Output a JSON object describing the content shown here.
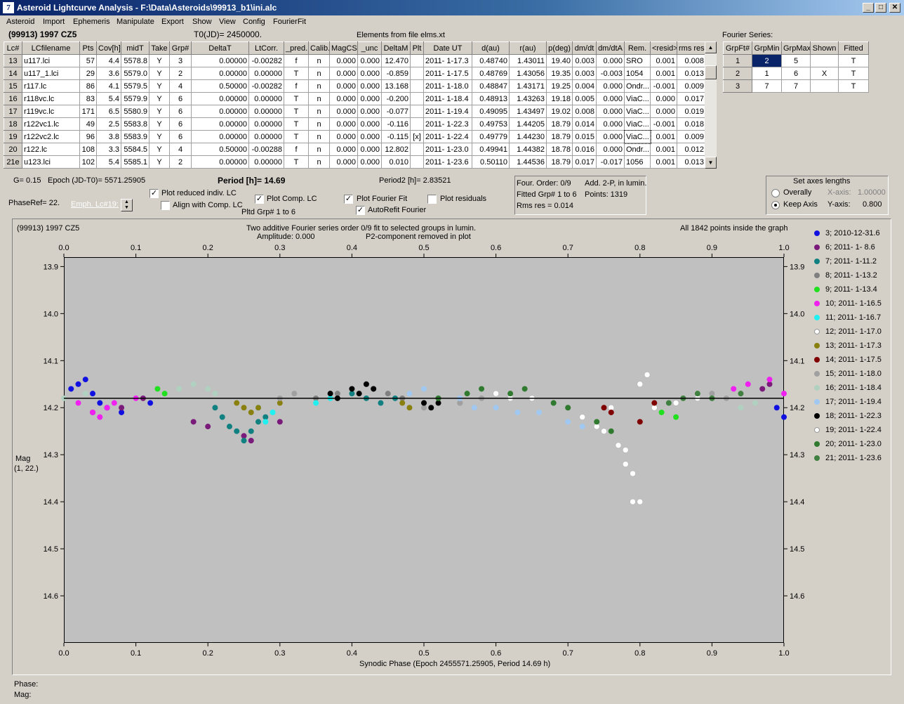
{
  "window": {
    "title": "Asteroid Lightcurve Analysis - F:\\Data\\Asteroids\\99913_b1\\ini.alc",
    "icon": "app-icon"
  },
  "menu": [
    "Asteroid",
    "Import",
    "Ephemeris",
    "Manipulate",
    "Export",
    "Show",
    "View",
    "Config",
    "FourierFit"
  ],
  "header": {
    "object": "(99913) 1997 CZ5",
    "t0": "T0(JD)= 2450000.",
    "elements": "Elements from file elms.xt"
  },
  "lc_table": {
    "columns": [
      "Lc#",
      "LCfilename",
      "Pts",
      "Cov[h]",
      "midT",
      "Take",
      "Grp#",
      "DeltaT",
      "LtCorr.",
      "_pred.",
      "Calib.",
      "MagCS",
      "_unc",
      "DeltaM",
      "Plt",
      "Date UT",
      "d(au)",
      "r(au)",
      "p(deg)",
      "dm/dt",
      "dm/dtA",
      "Rem.",
      "<resid>",
      "rms res"
    ],
    "rows": [
      [
        "13",
        "u117.lci",
        "57",
        "4.4",
        "5578.8",
        "Y",
        "3",
        "0.00000",
        "-0.00282",
        "f",
        "n",
        "0.000",
        "0.000",
        "12.470",
        "",
        "2011- 1-17.3",
        "0.48740",
        "1.43011",
        "19.40",
        "0.003",
        "0.000",
        "SRO",
        "0.001",
        "0.008"
      ],
      [
        "14",
        "u117_1.lci",
        "29",
        "3.6",
        "5579.0",
        "Y",
        "2",
        "0.00000",
        "0.00000",
        "T",
        "n",
        "0.000",
        "0.000",
        "-0.859",
        "",
        "2011- 1-17.5",
        "0.48769",
        "1.43056",
        "19.35",
        "0.003",
        "-0.003",
        "1054",
        "0.001",
        "0.013"
      ],
      [
        "15",
        "r117.lc",
        "86",
        "4.1",
        "5579.5",
        "Y",
        "4",
        "0.50000",
        "-0.00282",
        "f",
        "n",
        "0.000",
        "0.000",
        "13.168",
        "",
        "2011- 1-18.0",
        "0.48847",
        "1.43171",
        "19.25",
        "0.004",
        "0.000",
        "Ondr...",
        "-0.001",
        "0.009"
      ],
      [
        "16",
        "r118vc.lc",
        "83",
        "5.4",
        "5579.9",
        "Y",
        "6",
        "0.00000",
        "0.00000",
        "T",
        "n",
        "0.000",
        "0.000",
        "-0.200",
        "",
        "2011- 1-18.4",
        "0.48913",
        "1.43263",
        "19.18",
        "0.005",
        "0.000",
        "ViaC...",
        "0.000",
        "0.017"
      ],
      [
        "17",
        "r119vc.lc",
        "171",
        "6.5",
        "5580.9",
        "Y",
        "6",
        "0.00000",
        "0.00000",
        "T",
        "n",
        "0.000",
        "0.000",
        "-0.077",
        "",
        "2011- 1-19.4",
        "0.49095",
        "1.43497",
        "19.02",
        "0.008",
        "0.000",
        "ViaC...",
        "0.000",
        "0.019"
      ],
      [
        "18",
        "r122vc1.lc",
        "49",
        "2.5",
        "5583.8",
        "Y",
        "6",
        "0.00000",
        "0.00000",
        "T",
        "n",
        "0.000",
        "0.000",
        "-0.116",
        "",
        "2011- 1-22.3",
        "0.49753",
        "1.44205",
        "18.79",
        "0.014",
        "0.000",
        "ViaC...",
        "-0.001",
        "0.018"
      ],
      [
        "19",
        "r122vc2.lc",
        "96",
        "3.8",
        "5583.9",
        "Y",
        "6",
        "0.00000",
        "0.00000",
        "T",
        "n",
        "0.000",
        "0.000",
        "-0.115",
        "[x]",
        "2011- 1-22.4",
        "0.49779",
        "1.44230",
        "18.79",
        "0.015",
        "0.000",
        "ViaC...",
        "0.001",
        "0.009"
      ],
      [
        "20",
        "r122.lc",
        "108",
        "3.3",
        "5584.5",
        "Y",
        "4",
        "0.50000",
        "-0.00288",
        "f",
        "n",
        "0.000",
        "0.000",
        "12.802",
        "",
        "2011- 1-23.0",
        "0.49941",
        "1.44382",
        "18.78",
        "0.016",
        "0.000",
        "Ondr...",
        "0.001",
        "0.012"
      ],
      [
        "21e",
        "u123.lci",
        "102",
        "5.4",
        "5585.1",
        "Y",
        "2",
        "0.00000",
        "0.00000",
        "T",
        "n",
        "0.000",
        "0.000",
        "0.010",
        "",
        "2011- 1-23.6",
        "0.50110",
        "1.44536",
        "18.79",
        "0.017",
        "-0.017",
        "1056",
        "0.001",
        "0.013"
      ]
    ]
  },
  "fourier": {
    "title": "Fourier Series:",
    "columns": [
      "GrpFt#",
      "GrpMin",
      "GrpMax",
      "Shown",
      "Fitted"
    ],
    "rows": [
      [
        "1",
        "2",
        "5",
        "",
        "T"
      ],
      [
        "2",
        "1",
        "6",
        "X",
        "T"
      ],
      [
        "3",
        "7",
        "7",
        "",
        "T"
      ]
    ]
  },
  "params": {
    "g": "G= 0.15",
    "epoch": "Epoch (JD-T0)= 5571.25905",
    "period": "Period [h]= 14.69",
    "period2": "Period2 [h]= 2.83521",
    "phase_ref": "PhaseRef= 22.",
    "emph": "Emph. Lc#19:",
    "cb_reduced": "Plot reduced indiv. LC",
    "cb_align": "Align with Comp. LC",
    "cb_comp": "Plot Comp. LC",
    "pltd_grp": "Pltd Grp#  1   to   6",
    "cb_fourier": "Plot Fourier Fit",
    "cb_residuals": "Plot residuals",
    "cb_autorefit": "AutoRefit Fourier"
  },
  "fitinfo": {
    "order": "Four. Order:  0/9",
    "add": "Add. 2-P, in lumin.",
    "fitted": "Fitted Grp# 1 to 6",
    "points": "Points: 1319",
    "rms": "Rms res      = 0.014"
  },
  "axes_box": {
    "title": "Set axes lengths",
    "overally": "Overally",
    "keep": "Keep Axis",
    "xlabel": "X-axis:",
    "xval": "1.00000",
    "ylabel": "Y-axis:",
    "yval": "0.800"
  },
  "plot": {
    "object": "(99913) 1997 CZ5",
    "desc1": "Two additive Fourier series order 0/9 fit to selected groups in lumin.",
    "desc2": "Amplitude: 0.000",
    "desc3": "P2-component removed in plot",
    "inside": "All 1842 points inside the graph",
    "ylabel1": "Mag",
    "ylabel2": "(1, 22.)",
    "xlabel": "Synodic Phase (Epoch 2455571.25905, Period 14.69 h)"
  },
  "legend": [
    {
      "label": "3; 2010-12-31.6",
      "color": "#1010e0"
    },
    {
      "label": "6; 2011- 1- 8.6",
      "color": "#7a1a7a"
    },
    {
      "label": "7; 2011- 1-11.2",
      "color": "#108080"
    },
    {
      "label": "8; 2011- 1-13.2",
      "color": "#808080"
    },
    {
      "label": "9; 2011- 1-13.4",
      "color": "#20e020"
    },
    {
      "label": "10; 2011- 1-16.5",
      "color": "#f020f0"
    },
    {
      "label": "11; 2011- 1-16.7",
      "color": "#20f0f0"
    },
    {
      "label": "12; 2011- 1-17.0",
      "color": "#ffffff"
    },
    {
      "label": "13; 2011- 1-17.3",
      "color": "#8a8010"
    },
    {
      "label": "14; 2011- 1-17.5",
      "color": "#800000"
    },
    {
      "label": "15; 2011- 1-18.0",
      "color": "#a0a0a0"
    },
    {
      "label": "16; 2011- 1-18.4",
      "color": "#b0d0c0"
    },
    {
      "label": "17; 2011- 1-19.4",
      "color": "#a0c8f0"
    },
    {
      "label": "18; 2011- 1-22.3",
      "color": "#000000"
    },
    {
      "label": "19; 2011- 1-22.4",
      "color": "#ffffff"
    },
    {
      "label": "20; 2011- 1-23.0",
      "color": "#307a30"
    },
    {
      "label": "21; 2011- 1-23.6",
      "color": "#408040"
    }
  ],
  "chart_data": {
    "type": "scatter",
    "title": "",
    "xlabel": "Synodic Phase (Epoch 2455571.25905, Period 14.69 h)",
    "ylabel": "Mag",
    "xlim": [
      0.0,
      1.0
    ],
    "ylim": [
      14.7,
      13.88
    ],
    "x_ticks": [
      "0.0",
      "0.1",
      "0.2",
      "0.3",
      "0.4",
      "0.5",
      "0.6",
      "0.7",
      "0.8",
      "0.9",
      "1.0"
    ],
    "y_ticks": [
      "13.9",
      "14.0",
      "14.1",
      "14.2",
      "14.3",
      "14.4",
      "14.5",
      "14.6"
    ],
    "fourier_fit_mag": 14.18,
    "series": [
      {
        "color": "#1010e0",
        "x": [
          0.01,
          0.02,
          0.03,
          0.04,
          0.05,
          0.06,
          0.08,
          0.12,
          0.99,
          1.0
        ],
        "y": [
          14.16,
          14.15,
          14.14,
          14.17,
          14.19,
          14.2,
          14.21,
          14.19,
          14.2,
          14.22
        ]
      },
      {
        "color": "#7a1a7a",
        "x": [
          0.04,
          0.08,
          0.11,
          0.18,
          0.2,
          0.25,
          0.26,
          0.3,
          0.97,
          0.98
        ],
        "y": [
          14.21,
          14.2,
          14.18,
          14.23,
          14.24,
          14.26,
          14.27,
          14.23,
          14.16,
          14.15
        ]
      },
      {
        "color": "#108080",
        "x": [
          0.21,
          0.22,
          0.23,
          0.24,
          0.25,
          0.26,
          0.27,
          0.28,
          0.4,
          0.42,
          0.44,
          0.46
        ],
        "y": [
          14.2,
          14.22,
          14.24,
          14.25,
          14.27,
          14.25,
          14.23,
          14.22,
          14.17,
          14.18,
          14.19,
          14.18
        ]
      },
      {
        "color": "#808080",
        "x": [
          0.35,
          0.38,
          0.43,
          0.45,
          0.47,
          0.5,
          0.52,
          0.55
        ],
        "y": [
          14.18,
          14.17,
          14.16,
          14.17,
          14.18,
          14.19,
          14.18,
          14.19
        ]
      },
      {
        "color": "#20e020",
        "x": [
          0.13,
          0.14,
          0.82,
          0.83,
          0.85
        ],
        "y": [
          14.16,
          14.17,
          14.2,
          14.21,
          14.22
        ]
      },
      {
        "color": "#f020f0",
        "x": [
          0.02,
          0.04,
          0.05,
          0.06,
          0.07,
          0.1,
          0.93,
          0.95,
          0.98,
          1.0
        ],
        "y": [
          14.19,
          14.21,
          14.22,
          14.2,
          14.19,
          14.18,
          14.16,
          14.15,
          14.14,
          14.17
        ]
      },
      {
        "color": "#20f0f0",
        "x": [
          0.27,
          0.28,
          0.29,
          0.35,
          0.37
        ],
        "y": [
          14.2,
          14.23,
          14.21,
          14.19,
          14.18
        ]
      },
      {
        "color": "#ffffff",
        "x": [
          0.6,
          0.62,
          0.65,
          0.68,
          0.7,
          0.72,
          0.74,
          0.75,
          0.76,
          0.78,
          0.79,
          0.8,
          0.81,
          0.82,
          0.85,
          0.88
        ],
        "y": [
          14.17,
          14.18,
          14.18,
          14.19,
          14.2,
          14.22,
          14.24,
          14.25,
          14.2,
          14.32,
          14.34,
          14.15,
          14.13,
          14.2,
          14.19,
          14.18
        ]
      },
      {
        "color": "#8a8010",
        "x": [
          0.24,
          0.25,
          0.26,
          0.27,
          0.3,
          0.47,
          0.48
        ],
        "y": [
          14.19,
          14.2,
          14.21,
          14.2,
          14.19,
          14.19,
          14.2
        ]
      },
      {
        "color": "#800000",
        "x": [
          0.75,
          0.76,
          0.8,
          0.82
        ],
        "y": [
          14.2,
          14.21,
          14.23,
          14.19
        ]
      },
      {
        "color": "#a0a0a0",
        "x": [
          0.3,
          0.32,
          0.5,
          0.55,
          0.58,
          0.9,
          0.92
        ],
        "y": [
          14.18,
          14.17,
          14.2,
          14.19,
          14.18,
          14.17,
          14.18
        ]
      },
      {
        "color": "#b0d0c0",
        "x": [
          0.0,
          0.03,
          0.16,
          0.18,
          0.2,
          0.21,
          0.94,
          0.96
        ],
        "y": [
          14.18,
          14.17,
          14.16,
          14.15,
          14.16,
          14.17,
          14.2,
          14.19
        ]
      },
      {
        "color": "#a0c8f0",
        "x": [
          0.48,
          0.5,
          0.55,
          0.57,
          0.6,
          0.63,
          0.66,
          0.7,
          0.72
        ],
        "y": [
          14.17,
          14.16,
          14.18,
          14.2,
          14.2,
          14.21,
          14.21,
          14.23,
          14.24
        ]
      },
      {
        "color": "#000000",
        "x": [
          0.37,
          0.38,
          0.4,
          0.41,
          0.42,
          0.43,
          0.5,
          0.51,
          0.52
        ],
        "y": [
          14.17,
          14.18,
          14.16,
          14.17,
          14.15,
          14.16,
          14.19,
          14.2,
          14.19
        ]
      },
      {
        "color": "#ffffff",
        "x": [
          0.77,
          0.78,
          0.79,
          0.8
        ],
        "y": [
          14.28,
          14.29,
          14.4,
          14.4
        ]
      },
      {
        "color": "#307a30",
        "x": [
          0.52,
          0.56,
          0.58,
          0.62,
          0.64,
          0.68,
          0.7,
          0.74,
          0.76
        ],
        "y": [
          14.18,
          14.17,
          14.16,
          14.17,
          14.16,
          14.19,
          14.2,
          14.23,
          14.25
        ]
      },
      {
        "color": "#408040",
        "x": [
          0.84,
          0.86,
          0.88,
          0.9,
          0.94
        ],
        "y": [
          14.19,
          14.18,
          14.17,
          14.18,
          14.17
        ]
      }
    ]
  }
}
